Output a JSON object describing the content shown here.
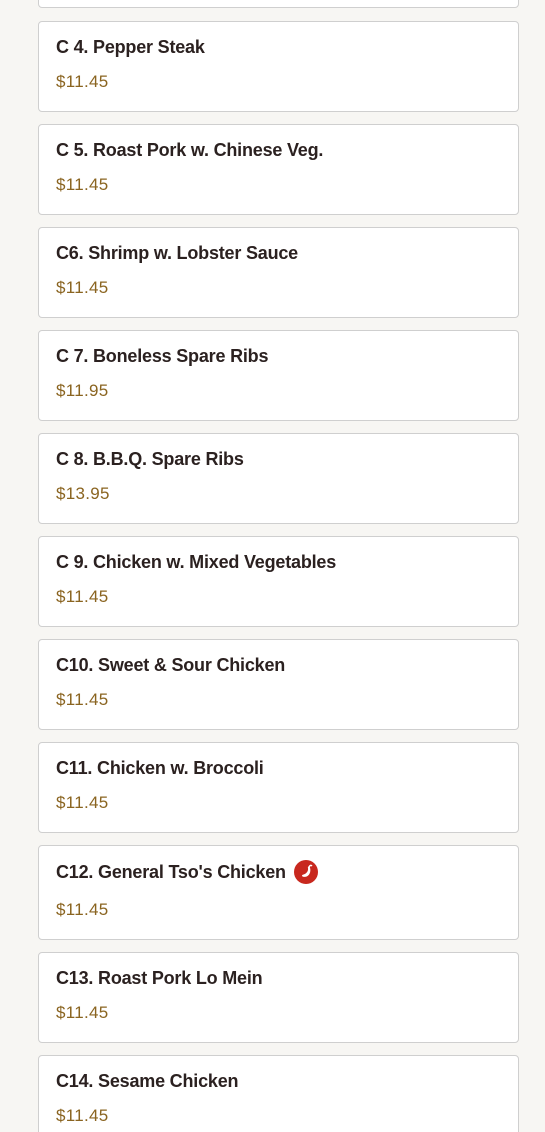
{
  "menu": {
    "items": [
      {
        "name": "",
        "price": ""
      },
      {
        "name": "C 4. Pepper Steak",
        "price": "$11.45"
      },
      {
        "name": "C 5. Roast Pork w. Chinese Veg.",
        "price": "$11.45"
      },
      {
        "name": "C6. Shrimp w. Lobster Sauce",
        "price": "$11.45"
      },
      {
        "name": "C 7. Boneless Spare Ribs",
        "price": "$11.95"
      },
      {
        "name": "C 8. B.B.Q. Spare Ribs",
        "price": "$13.95"
      },
      {
        "name": "C 9. Chicken w. Mixed Vegetables",
        "price": "$11.45"
      },
      {
        "name": "C10. Sweet & Sour Chicken",
        "price": "$11.45"
      },
      {
        "name": "C11. Chicken w. Broccoli",
        "price": "$11.45"
      },
      {
        "name": "C12. General Tso's Chicken",
        "price": "$11.45",
        "icon": "chili-pepper-icon"
      },
      {
        "name": "C13. Roast Pork Lo Mein",
        "price": "$11.45"
      },
      {
        "name": "C14. Sesame Chicken",
        "price": "$11.45"
      }
    ]
  },
  "colors": {
    "background": "#f7f6f3",
    "card": "#ffffff",
    "title": "#2b2120",
    "price": "#8a6420",
    "spicy": "#c8281e"
  }
}
